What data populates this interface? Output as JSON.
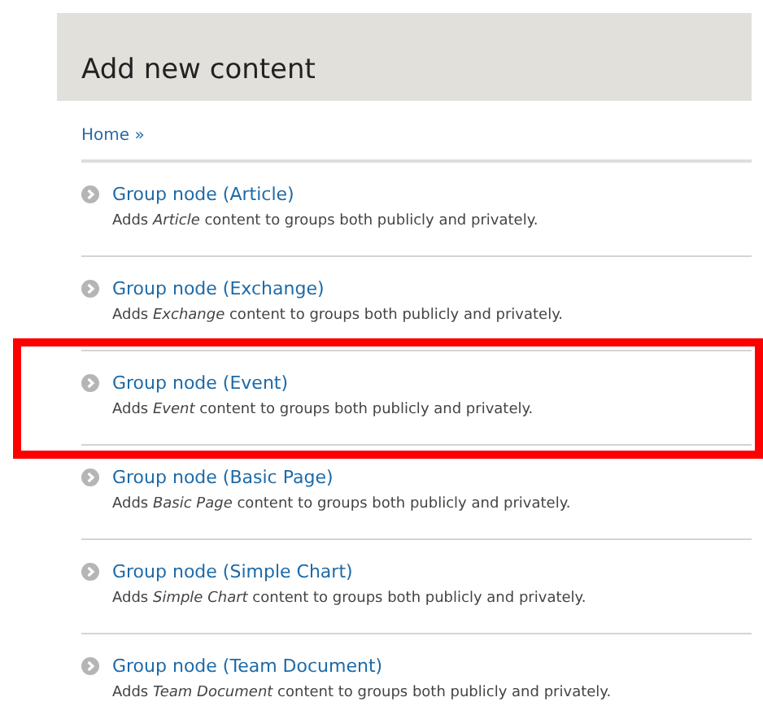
{
  "page": {
    "title": "Add new content"
  },
  "breadcrumb": [
    "Home »"
  ],
  "items": [
    {
      "title": "Group node (Article)",
      "description": "Adds *Article* content to groups both publicly and privately.",
      "highlighted": false
    },
    {
      "title": "Group node (Exchange)",
      "description": "Adds *Exchange* content to groups both publicly and privately.",
      "highlighted": false
    },
    {
      "title": "Group node (Event)",
      "description": "Adds *Event* content to groups both publicly and privately.",
      "highlighted": true
    },
    {
      "title": "Group node (Basic Page)",
      "description": "Adds *Basic Page* content to groups both publicly and privately.",
      "highlighted": false
    },
    {
      "title": "Group node (Simple Chart)",
      "description": "Adds *Simple Chart* content to groups both publicly and privately.",
      "highlighted": false
    },
    {
      "title": "Group node (Team Document)",
      "description": "Adds *Team Document* content to groups both publicly and privately.",
      "highlighted": false
    }
  ]
}
